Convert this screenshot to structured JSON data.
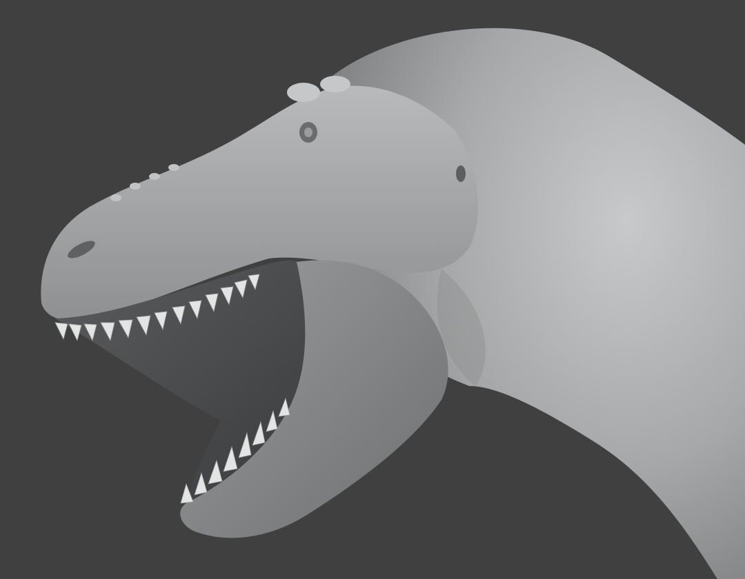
{
  "viewport": {
    "background_color": "#404040",
    "subject": "sculpt-dinosaur-head",
    "model_color": "#a9abac",
    "shadow_color": "#2f2f2f"
  },
  "icons": {
    "teeth": "tooth-shape",
    "eye": "eye-socket-shape",
    "nostril": "nostril-shape"
  }
}
